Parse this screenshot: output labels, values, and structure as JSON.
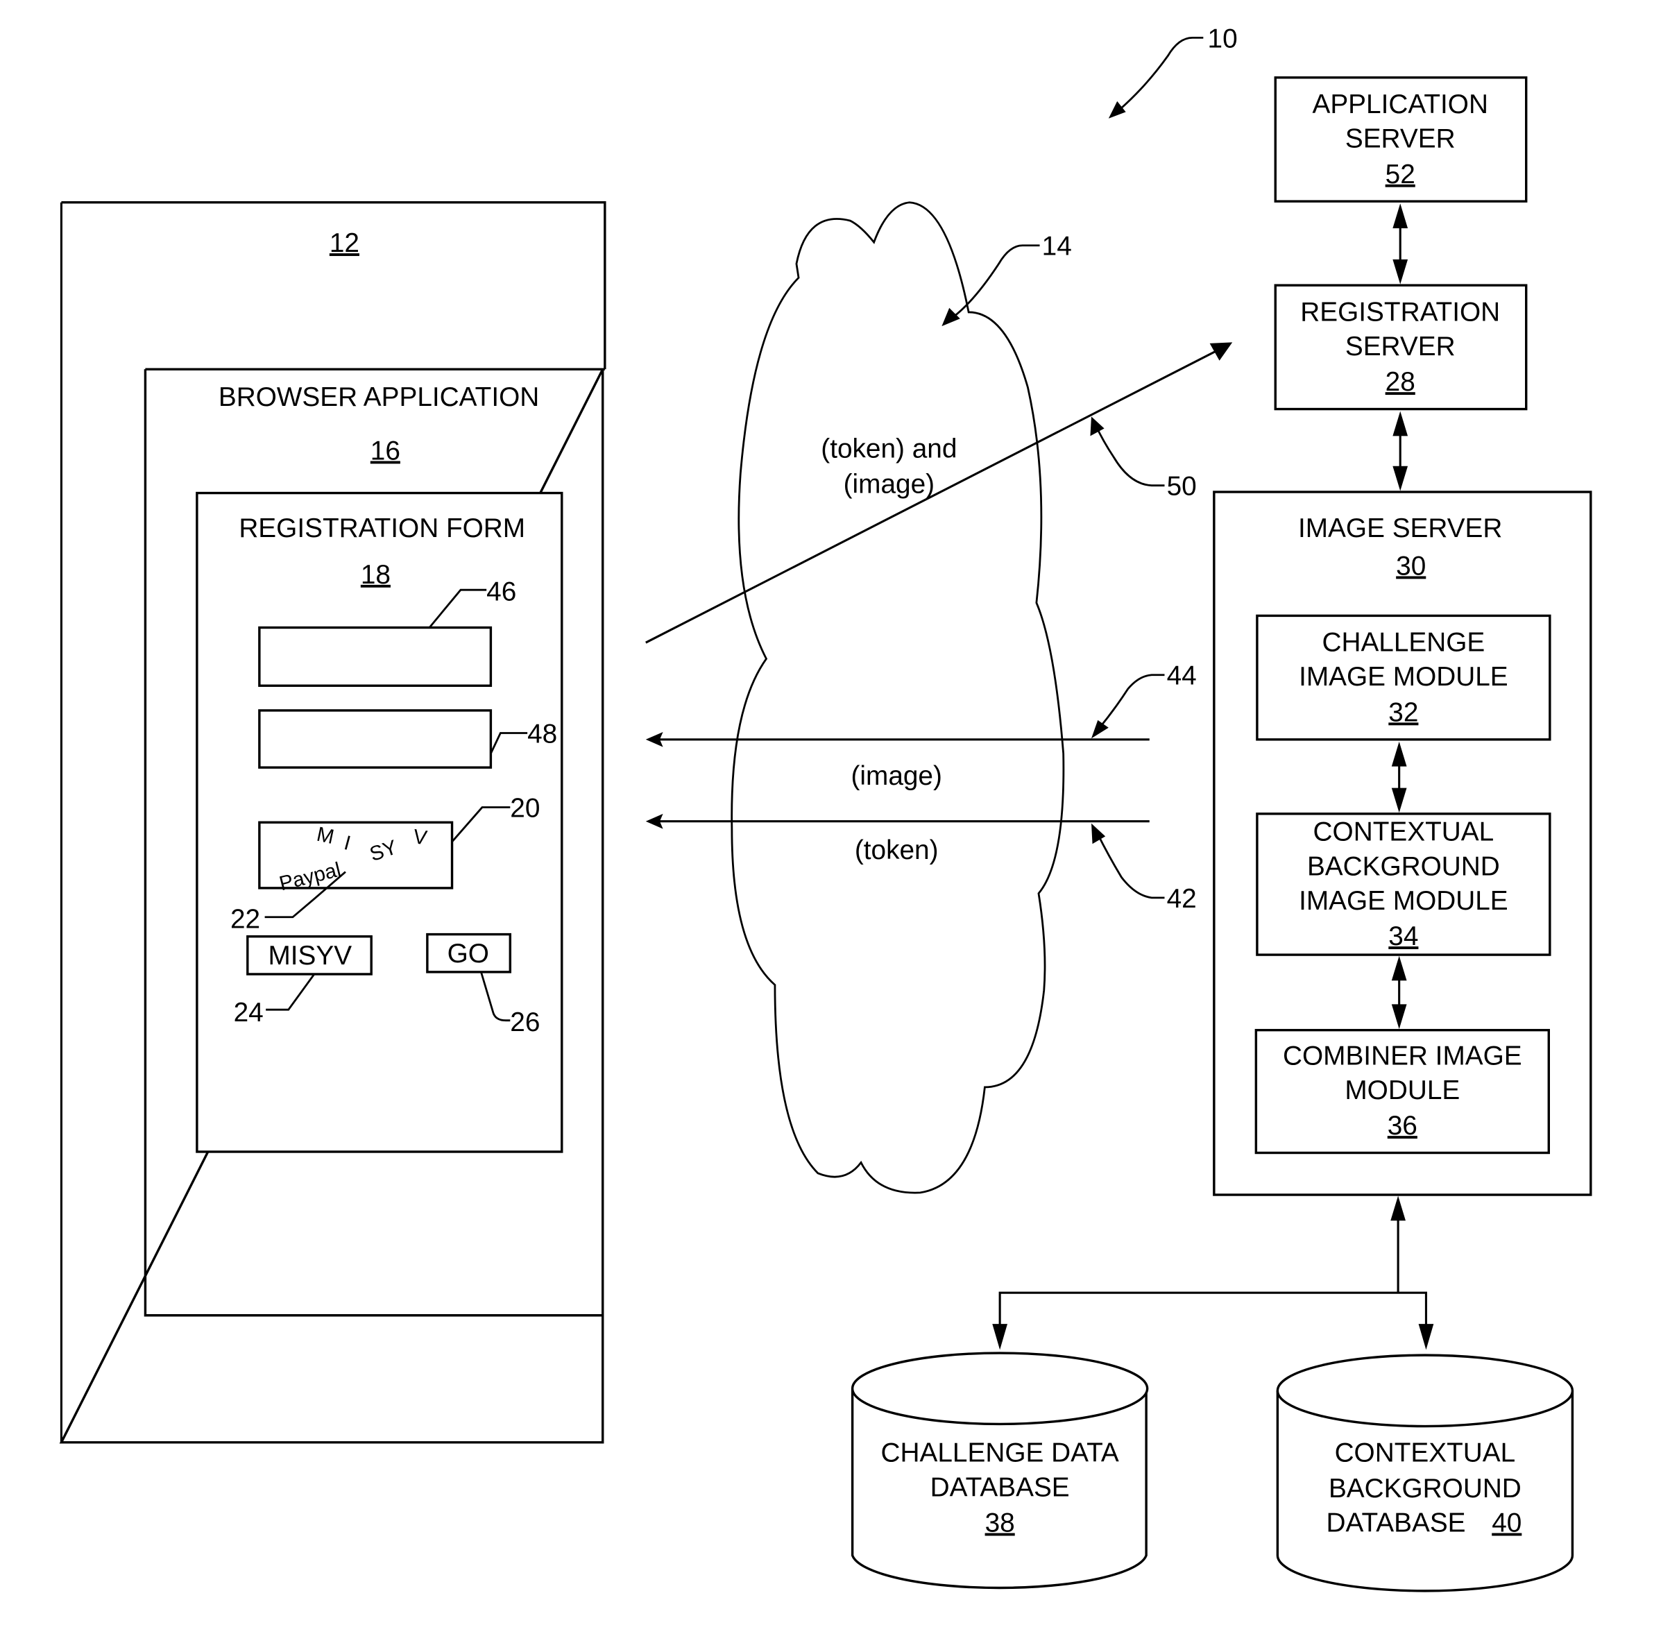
{
  "figure": {
    "ref": "10"
  },
  "client": {
    "ref": "12",
    "browser": {
      "title": "BROWSER APPLICATION",
      "ref": "16",
      "form": {
        "title": "REGISTRATION FORM",
        "ref": "18",
        "field_1_ref": "46",
        "field_2_ref": "48",
        "captcha": {
          "ref": "20",
          "challenge_chars": [
            "M",
            "I",
            "SY",
            "V"
          ],
          "background_text": "Paypal",
          "background_ref": "22"
        },
        "answer_input": {
          "value": "MISYV",
          "ref": "24"
        },
        "go_button": {
          "label": "GO",
          "ref": "26"
        }
      }
    }
  },
  "network": {
    "ref": "14",
    "flows": [
      {
        "ref": "50",
        "label_line1": "(token) and",
        "label_line2": "(image)",
        "direction": "to-registration-server"
      },
      {
        "ref": "44",
        "label": "(image)",
        "direction": "to-client"
      },
      {
        "ref": "42",
        "label": "(token)",
        "direction": "to-client"
      }
    ]
  },
  "servers": {
    "application": {
      "line1": "APPLICATION",
      "line2": "SERVER",
      "ref": "52"
    },
    "registration": {
      "line1": "REGISTRATION",
      "line2": "SERVER",
      "ref": "28"
    },
    "image": {
      "title": "IMAGE SERVER",
      "ref": "30",
      "modules": [
        {
          "line1": "CHALLENGE",
          "line2": "IMAGE MODULE",
          "ref": "32"
        },
        {
          "line1": "CONTEXTUAL",
          "line2": "BACKGROUND",
          "line3": "IMAGE MODULE",
          "ref": "34"
        },
        {
          "line1": "COMBINER IMAGE",
          "line2": "MODULE",
          "ref": "36"
        }
      ]
    }
  },
  "databases": [
    {
      "line1": "CHALLENGE DATA",
      "line2": "DATABASE",
      "ref": "38"
    },
    {
      "line1": "CONTEXTUAL",
      "line2": "BACKGROUND",
      "line3": "DATABASE",
      "ref": "40"
    }
  ]
}
